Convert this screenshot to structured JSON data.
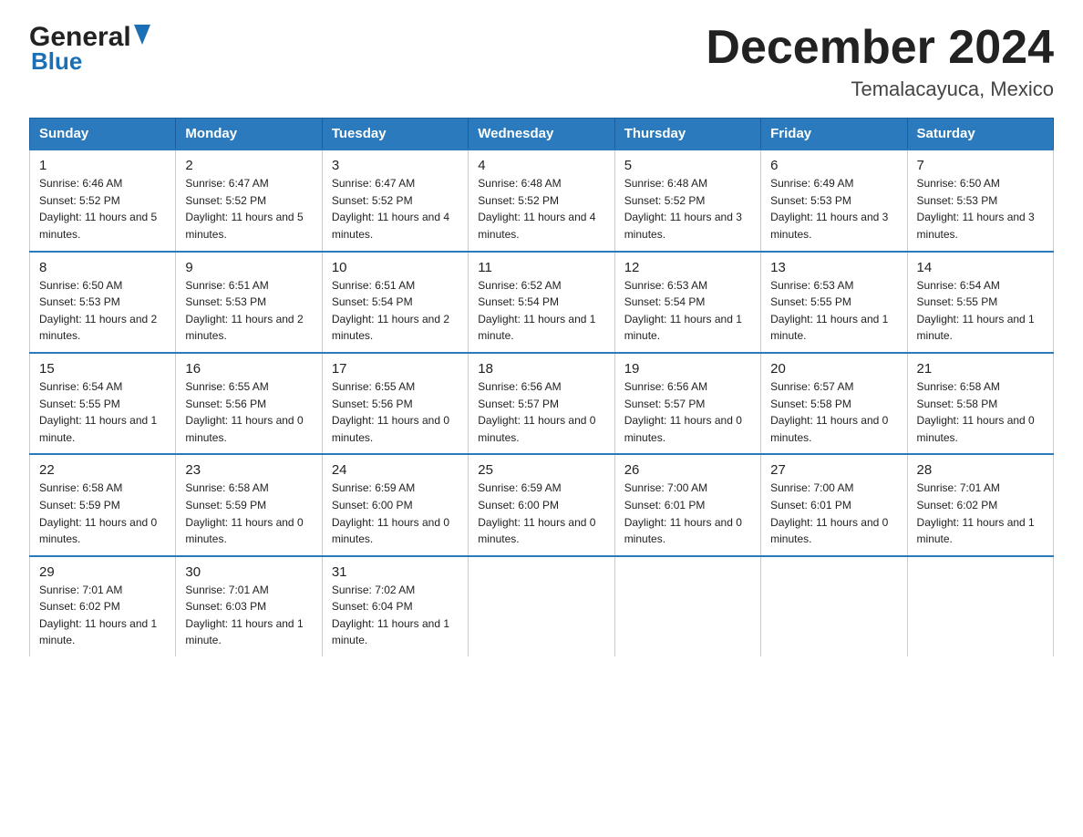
{
  "header": {
    "logo_general": "General",
    "logo_blue": "Blue",
    "main_title": "December 2024",
    "subtitle": "Temalacayuca, Mexico"
  },
  "columns": [
    "Sunday",
    "Monday",
    "Tuesday",
    "Wednesday",
    "Thursday",
    "Friday",
    "Saturday"
  ],
  "weeks": [
    {
      "days": [
        {
          "num": "1",
          "sunrise": "6:46 AM",
          "sunset": "5:52 PM",
          "daylight": "11 hours and 5 minutes."
        },
        {
          "num": "2",
          "sunrise": "6:47 AM",
          "sunset": "5:52 PM",
          "daylight": "11 hours and 5 minutes."
        },
        {
          "num": "3",
          "sunrise": "6:47 AM",
          "sunset": "5:52 PM",
          "daylight": "11 hours and 4 minutes."
        },
        {
          "num": "4",
          "sunrise": "6:48 AM",
          "sunset": "5:52 PM",
          "daylight": "11 hours and 4 minutes."
        },
        {
          "num": "5",
          "sunrise": "6:48 AM",
          "sunset": "5:52 PM",
          "daylight": "11 hours and 3 minutes."
        },
        {
          "num": "6",
          "sunrise": "6:49 AM",
          "sunset": "5:53 PM",
          "daylight": "11 hours and 3 minutes."
        },
        {
          "num": "7",
          "sunrise": "6:50 AM",
          "sunset": "5:53 PM",
          "daylight": "11 hours and 3 minutes."
        }
      ]
    },
    {
      "days": [
        {
          "num": "8",
          "sunrise": "6:50 AM",
          "sunset": "5:53 PM",
          "daylight": "11 hours and 2 minutes."
        },
        {
          "num": "9",
          "sunrise": "6:51 AM",
          "sunset": "5:53 PM",
          "daylight": "11 hours and 2 minutes."
        },
        {
          "num": "10",
          "sunrise": "6:51 AM",
          "sunset": "5:54 PM",
          "daylight": "11 hours and 2 minutes."
        },
        {
          "num": "11",
          "sunrise": "6:52 AM",
          "sunset": "5:54 PM",
          "daylight": "11 hours and 1 minute."
        },
        {
          "num": "12",
          "sunrise": "6:53 AM",
          "sunset": "5:54 PM",
          "daylight": "11 hours and 1 minute."
        },
        {
          "num": "13",
          "sunrise": "6:53 AM",
          "sunset": "5:55 PM",
          "daylight": "11 hours and 1 minute."
        },
        {
          "num": "14",
          "sunrise": "6:54 AM",
          "sunset": "5:55 PM",
          "daylight": "11 hours and 1 minute."
        }
      ]
    },
    {
      "days": [
        {
          "num": "15",
          "sunrise": "6:54 AM",
          "sunset": "5:55 PM",
          "daylight": "11 hours and 1 minute."
        },
        {
          "num": "16",
          "sunrise": "6:55 AM",
          "sunset": "5:56 PM",
          "daylight": "11 hours and 0 minutes."
        },
        {
          "num": "17",
          "sunrise": "6:55 AM",
          "sunset": "5:56 PM",
          "daylight": "11 hours and 0 minutes."
        },
        {
          "num": "18",
          "sunrise": "6:56 AM",
          "sunset": "5:57 PM",
          "daylight": "11 hours and 0 minutes."
        },
        {
          "num": "19",
          "sunrise": "6:56 AM",
          "sunset": "5:57 PM",
          "daylight": "11 hours and 0 minutes."
        },
        {
          "num": "20",
          "sunrise": "6:57 AM",
          "sunset": "5:58 PM",
          "daylight": "11 hours and 0 minutes."
        },
        {
          "num": "21",
          "sunrise": "6:58 AM",
          "sunset": "5:58 PM",
          "daylight": "11 hours and 0 minutes."
        }
      ]
    },
    {
      "days": [
        {
          "num": "22",
          "sunrise": "6:58 AM",
          "sunset": "5:59 PM",
          "daylight": "11 hours and 0 minutes."
        },
        {
          "num": "23",
          "sunrise": "6:58 AM",
          "sunset": "5:59 PM",
          "daylight": "11 hours and 0 minutes."
        },
        {
          "num": "24",
          "sunrise": "6:59 AM",
          "sunset": "6:00 PM",
          "daylight": "11 hours and 0 minutes."
        },
        {
          "num": "25",
          "sunrise": "6:59 AM",
          "sunset": "6:00 PM",
          "daylight": "11 hours and 0 minutes."
        },
        {
          "num": "26",
          "sunrise": "7:00 AM",
          "sunset": "6:01 PM",
          "daylight": "11 hours and 0 minutes."
        },
        {
          "num": "27",
          "sunrise": "7:00 AM",
          "sunset": "6:01 PM",
          "daylight": "11 hours and 0 minutes."
        },
        {
          "num": "28",
          "sunrise": "7:01 AM",
          "sunset": "6:02 PM",
          "daylight": "11 hours and 1 minute."
        }
      ]
    },
    {
      "days": [
        {
          "num": "29",
          "sunrise": "7:01 AM",
          "sunset": "6:02 PM",
          "daylight": "11 hours and 1 minute."
        },
        {
          "num": "30",
          "sunrise": "7:01 AM",
          "sunset": "6:03 PM",
          "daylight": "11 hours and 1 minute."
        },
        {
          "num": "31",
          "sunrise": "7:02 AM",
          "sunset": "6:04 PM",
          "daylight": "11 hours and 1 minute."
        },
        {
          "num": "",
          "sunrise": "",
          "sunset": "",
          "daylight": ""
        },
        {
          "num": "",
          "sunrise": "",
          "sunset": "",
          "daylight": ""
        },
        {
          "num": "",
          "sunrise": "",
          "sunset": "",
          "daylight": ""
        },
        {
          "num": "",
          "sunrise": "",
          "sunset": "",
          "daylight": ""
        }
      ]
    }
  ]
}
